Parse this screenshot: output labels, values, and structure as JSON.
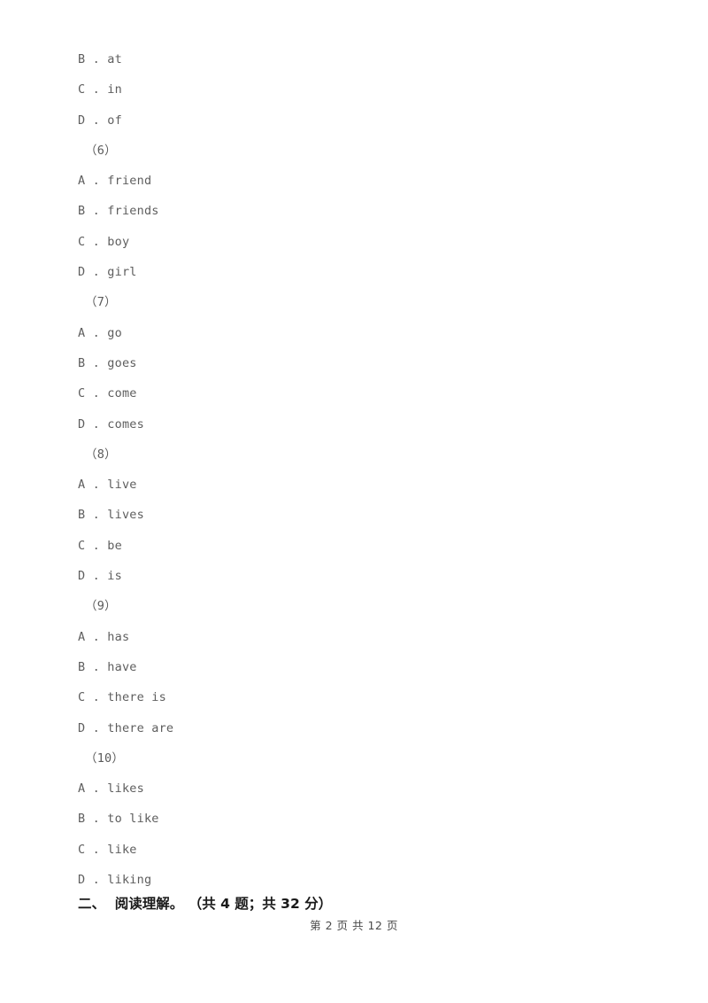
{
  "document": {
    "page_footer": "第 2 页 共 12 页",
    "section_heading": "二、  阅读理解。 （共 4 题；共 32 分）"
  },
  "body_lines": [
    {
      "type": "option",
      "text": "B . at"
    },
    {
      "type": "option",
      "text": "C . in"
    },
    {
      "type": "option",
      "text": "D . of"
    },
    {
      "type": "qnum",
      "text": "（6）"
    },
    {
      "type": "option",
      "text": "A . friend"
    },
    {
      "type": "option",
      "text": "B . friends"
    },
    {
      "type": "option",
      "text": "C . boy"
    },
    {
      "type": "option",
      "text": "D . girl"
    },
    {
      "type": "qnum",
      "text": "（7）"
    },
    {
      "type": "option",
      "text": "A . go"
    },
    {
      "type": "option",
      "text": "B . goes"
    },
    {
      "type": "option",
      "text": "C . come"
    },
    {
      "type": "option",
      "text": "D . comes"
    },
    {
      "type": "qnum",
      "text": "（8）"
    },
    {
      "type": "option",
      "text": "A . live"
    },
    {
      "type": "option",
      "text": "B . lives"
    },
    {
      "type": "option",
      "text": "C . be"
    },
    {
      "type": "option",
      "text": "D . is"
    },
    {
      "type": "qnum",
      "text": "（9）"
    },
    {
      "type": "option",
      "text": "A . has"
    },
    {
      "type": "option",
      "text": "B . have"
    },
    {
      "type": "option",
      "text": "C . there is"
    },
    {
      "type": "option",
      "text": "D . there are"
    },
    {
      "type": "qnum",
      "text": "（10）"
    },
    {
      "type": "option",
      "text": "A . likes"
    },
    {
      "type": "option",
      "text": "B . to like"
    },
    {
      "type": "option",
      "text": "C . like"
    },
    {
      "type": "option",
      "text": "D . liking"
    }
  ]
}
